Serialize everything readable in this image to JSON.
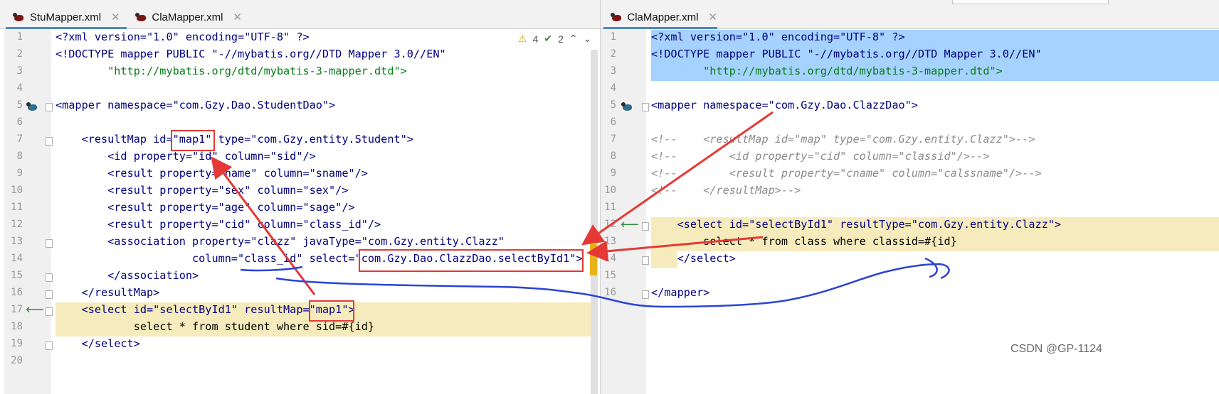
{
  "left_editor": {
    "tabs": [
      {
        "label": "StuMapper.xml",
        "active": true
      },
      {
        "label": "ClaMapper.xml",
        "active": false
      }
    ],
    "inspections": {
      "warnings": "4",
      "checks": "2"
    },
    "line_numbers": [
      "1",
      "2",
      "3",
      "4",
      "5",
      "6",
      "7",
      "8",
      "9",
      "10",
      "11",
      "12",
      "13",
      "14",
      "15",
      "16",
      "17",
      "18",
      "19",
      "20"
    ],
    "lines": [
      "<?xml version=\"1.0\" encoding=\"UTF-8\" ?>",
      "<!DOCTYPE mapper PUBLIC \"-//mybatis.org//DTD Mapper 3.0//EN\"",
      "        \"http://mybatis.org/dtd/mybatis-3-mapper.dtd\">",
      "",
      "<mapper namespace=\"com.Gzy.Dao.StudentDao\">",
      "",
      "    <resultMap id=\"map1\" type=\"com.Gzy.entity.Student\">",
      "        <id property=\"id\" column=\"sid\"/>",
      "        <result property=\"name\" column=\"sname\"/>",
      "        <result property=\"sex\" column=\"sex\"/>",
      "        <result property=\"age\" column=\"sage\"/>",
      "        <result property=\"cid\" column=\"class_id\"/>",
      "        <association property=\"clazz\" javaType=\"com.Gzy.entity.Clazz\"",
      "                     column=\"class_id\" select=\"com.Gzy.Dao.ClazzDao.selectById1\">",
      "        </association>",
      "    </resultMap>",
      "    <select id=\"selectById1\" resultMap=\"map1\">",
      "            select * from student where sid=#{id}",
      "    </select>",
      ""
    ]
  },
  "right_editor": {
    "tabs": [
      {
        "label": "ClaMapper.xml",
        "active": true
      }
    ],
    "line_numbers": [
      "1",
      "2",
      "3",
      "4",
      "5",
      "6",
      "7",
      "8",
      "9",
      "10",
      "11",
      "12",
      "13",
      "14",
      "15",
      "16"
    ],
    "lines": [
      "<?xml version=\"1.0\" encoding=\"UTF-8\" ?>",
      "<!DOCTYPE mapper PUBLIC \"-//mybatis.org//DTD Mapper 3.0//EN\"",
      "        \"http://mybatis.org/dtd/mybatis-3-mapper.dtd\">",
      "",
      "<mapper namespace=\"com.Gzy.Dao.ClazzDao\">",
      "",
      "<!--    <resultMap id=\"map\" type=\"com.Gzy.entity.Clazz\">-->",
      "<!--        <id property=\"cid\" column=\"classid\"/>-->",
      "<!--        <result property=\"cname\" column=\"calssname\"/>-->",
      "<!--    </resultMap>-->",
      "",
      "    <select id=\"selectById1\" resultType=\"com.Gzy.entity.Clazz\">",
      "        select * from class where classid=#{id}",
      "    </select>",
      "",
      "</mapper>"
    ]
  },
  "watermark": "CSDN @GP-1124",
  "colors": {
    "annotation_red": "#e53935",
    "annotation_blue": "#2a44d6",
    "selection_blue": "#a6d2ff",
    "caret_row": "#f6ebbc"
  },
  "icons": [
    "mybatis-bird-icon",
    "navigate-back-arrow-icon",
    "warning-icon",
    "check-icon",
    "chevron-up-icon",
    "chevron-down-icon",
    "close-icon"
  ]
}
